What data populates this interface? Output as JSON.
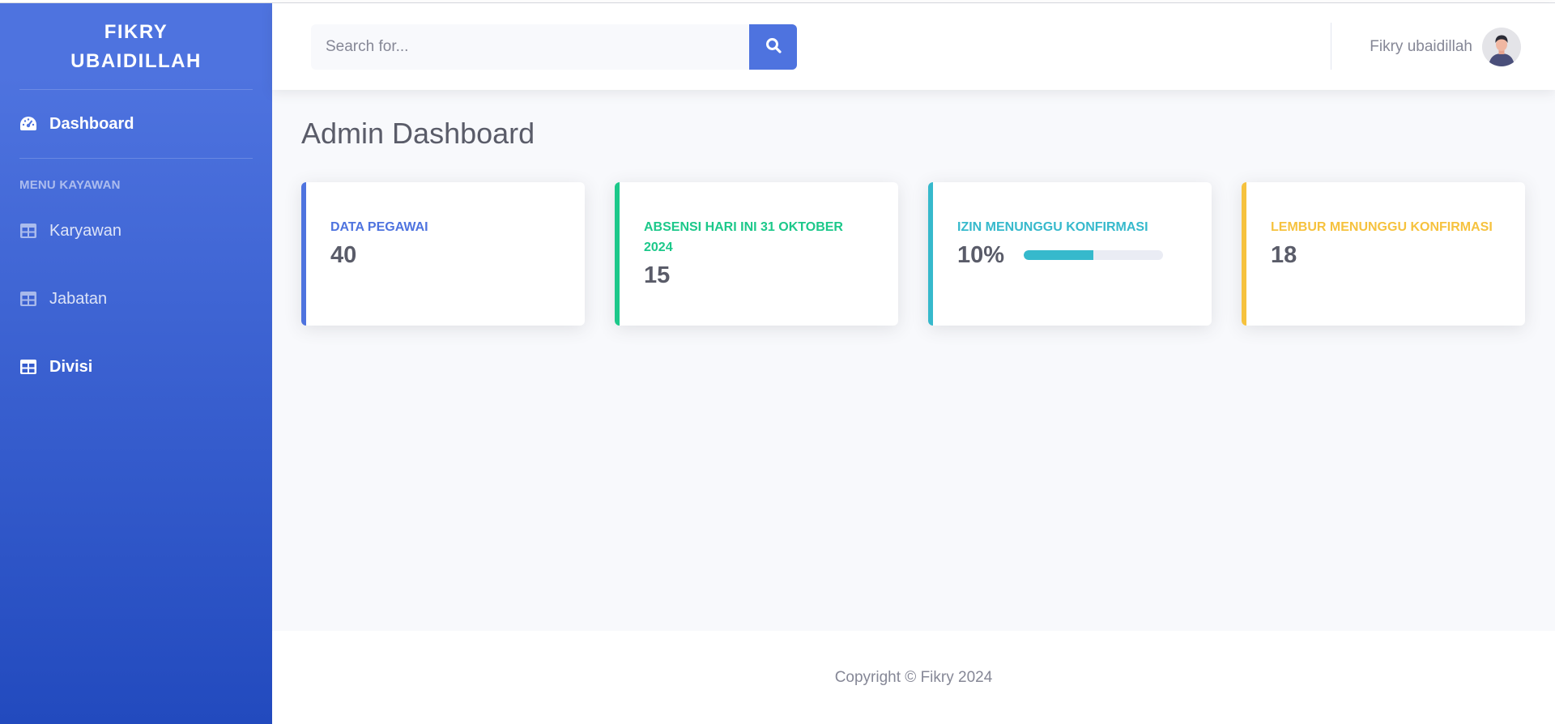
{
  "sidebar": {
    "brand_line1": "FIKRY",
    "brand_line2": "UBAIDILLAH",
    "dashboard": {
      "label": "Dashboard",
      "icon": "tachometer-icon"
    },
    "heading": "MENU KAYAWAN",
    "items": [
      {
        "label": "Karyawan",
        "icon": "table-icon"
      },
      {
        "label": "Jabatan",
        "icon": "table-icon"
      },
      {
        "label": "Divisi",
        "icon": "table-icon"
      }
    ]
  },
  "topbar": {
    "search_placeholder": "Search for...",
    "search_icon": "search-icon",
    "user_name": "Fikry ubaidillah"
  },
  "page": {
    "title": "Admin Dashboard"
  },
  "cards": [
    {
      "label": "DATA PEGAWAI",
      "value": "40",
      "accent": "#4e73df"
    },
    {
      "label": "ABSENSI HARI INI 31 OKTOBER 2024",
      "value": "15",
      "accent": "#1cc88a"
    },
    {
      "label": "IZIN MENUNGGU KONFIRMASI",
      "value": "10%",
      "accent": "#36b9cc",
      "progress_fraction": 0.5
    },
    {
      "label": "LEMBUR MENUNGGU KONFIRMASI",
      "value": "18",
      "accent": "#f6c23e"
    }
  ],
  "footer": {
    "text": "Copyright © Fikry 2024"
  }
}
